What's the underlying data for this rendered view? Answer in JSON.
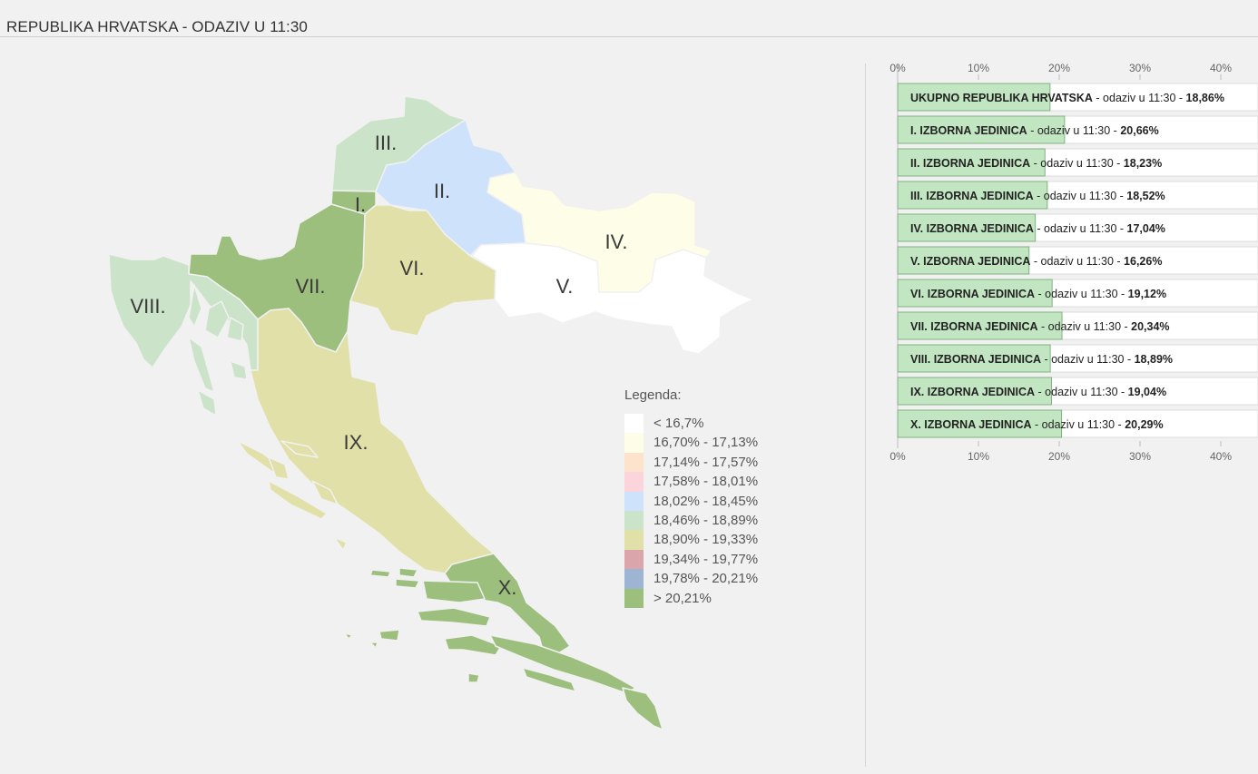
{
  "header": {
    "title": "REPUBLIKA HRVATSKA - ODAZIV U 11:30"
  },
  "legend": {
    "title": "Legenda:",
    "items": [
      {
        "label": "< 16,7%",
        "color": "#ffffff"
      },
      {
        "label": "16,70% - 17,13%",
        "color": "#fefee8"
      },
      {
        "label": "17,14% - 17,57%",
        "color": "#fde2cc"
      },
      {
        "label": "17,58% - 18,01%",
        "color": "#fcd4dc"
      },
      {
        "label": "18,02% - 18,45%",
        "color": "#cfe2fb"
      },
      {
        "label": "18,46% - 18,89%",
        "color": "#cbe3c8"
      },
      {
        "label": "18,90% - 19,33%",
        "color": "#e1e0a8"
      },
      {
        "label": "19,34% - 19,77%",
        "color": "#dba5ac"
      },
      {
        "label": "19,78% - 20,21%",
        "color": "#9db4d3"
      },
      {
        "label": "> 20,21%",
        "color": "#9cbf7e"
      }
    ]
  },
  "map": {
    "regions": [
      {
        "label": "I.",
        "value": 20.66,
        "color": "#9cbf7e"
      },
      {
        "label": "II.",
        "value": 18.23,
        "color": "#cfe2fb"
      },
      {
        "label": "III.",
        "value": 18.52,
        "color": "#cbe3c8"
      },
      {
        "label": "IV.",
        "value": 17.04,
        "color": "#fefee8"
      },
      {
        "label": "V.",
        "value": 16.26,
        "color": "#ffffff"
      },
      {
        "label": "VI.",
        "value": 19.12,
        "color": "#e1e0a8"
      },
      {
        "label": "VII.",
        "value": 20.34,
        "color": "#9cbf7e"
      },
      {
        "label": "VIII.",
        "value": 18.89,
        "color": "#cbe3c8"
      },
      {
        "label": "IX.",
        "value": 19.04,
        "color": "#e1e0a8"
      },
      {
        "label": "X.",
        "value": 20.29,
        "color": "#9cbf7e"
      }
    ]
  },
  "chart_data": {
    "type": "bar",
    "orientation": "horizontal",
    "title": "REPUBLIKA HRVATSKA - ODAZIV U 11:30",
    "xlim": [
      0,
      44
    ],
    "ticks": [
      0,
      10,
      20,
      30,
      40
    ],
    "tick_labels": [
      "0%",
      "10%",
      "20%",
      "30%",
      "40%"
    ],
    "grid": false,
    "bar_color": "#c3e6c2",
    "bar_border": "#7fb27f",
    "connector": " - odaziv u 11:30 - ",
    "categories": [
      "UKUPNO REPUBLIKA HRVATSKA",
      "I. IZBORNA JEDINICA",
      "II. IZBORNA JEDINICA",
      "III. IZBORNA JEDINICA",
      "IV. IZBORNA JEDINICA",
      "V. IZBORNA JEDINICA",
      "VI. IZBORNA JEDINICA",
      "VII. IZBORNA JEDINICA",
      "VIII. IZBORNA JEDINICA",
      "IX. IZBORNA JEDINICA",
      "X. IZBORNA JEDINICA"
    ],
    "values": [
      18.86,
      20.66,
      18.23,
      18.52,
      17.04,
      16.26,
      19.12,
      20.34,
      18.89,
      19.04,
      20.29
    ],
    "value_labels": [
      "18,86%",
      "20,66%",
      "18,23%",
      "18,52%",
      "17,04%",
      "16,26%",
      "19,12%",
      "20,34%",
      "18,89%",
      "19,04%",
      "20,29%"
    ]
  }
}
